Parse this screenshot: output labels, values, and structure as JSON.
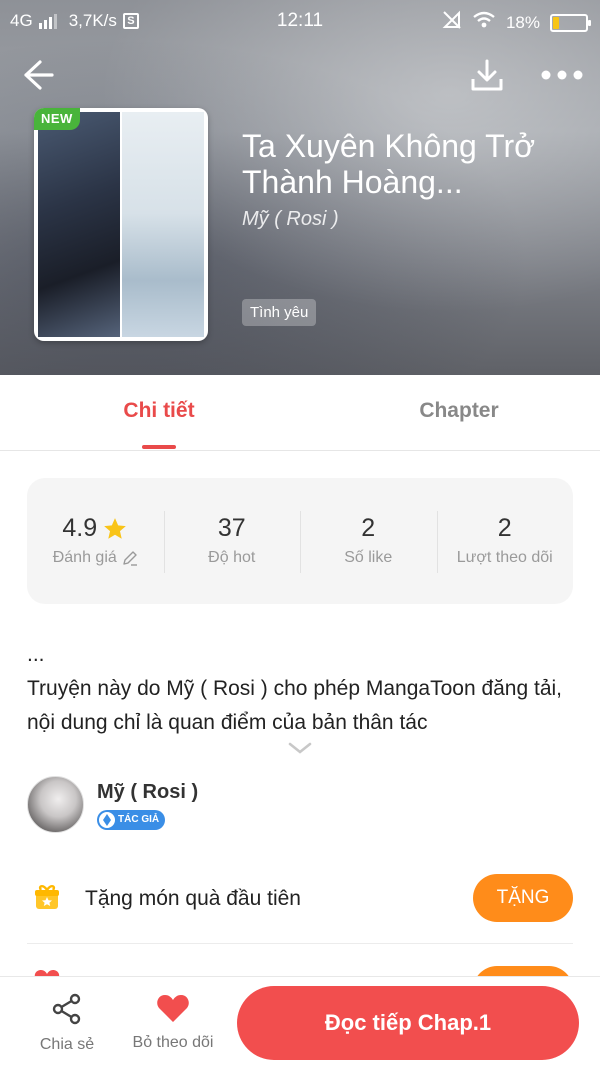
{
  "status_bar": {
    "network": "4G",
    "speed": "3,7K/s",
    "sim_icon": "S",
    "time": "12:11",
    "battery_percent": "18%",
    "battery_level": 0.18,
    "battery_color": "#f7c516"
  },
  "header": {
    "back_icon": "arrow-left-icon",
    "download_icon": "download-icon",
    "more_icon": "more-dots-icon"
  },
  "book": {
    "badge": "NEW",
    "title": "Ta Xuyên Không Trở Thành Hoàng...",
    "author": "Mỹ ( Rosi )",
    "genre": "Tình yêu"
  },
  "tabs": {
    "detail": "Chi tiết",
    "chapter": "Chapter",
    "active": "detail",
    "active_color": "#e94a4a"
  },
  "stats": {
    "rating_value": "4.9",
    "rating_label": "Đánh giá",
    "hot_value": "37",
    "hot_label": "Độ hot",
    "like_value": "2",
    "like_label": "Số like",
    "follow_value": "2",
    "follow_label": "Lượt theo dõi"
  },
  "description": {
    "ellipsis": "...",
    "text": "Truyện này do Mỹ ( Rosi ) cho phép MangaToon đăng tải, nội dung chỉ là quan điểm của bản thân tác"
  },
  "author_row": {
    "name": "Mỹ ( Rosi )",
    "badge": "TÁC GIẢ"
  },
  "gift": {
    "label": "Tặng món quà đầu tiên",
    "button": "TẶNG",
    "button_color": "#ff8c1a"
  },
  "bottom_bar": {
    "share_label": "Chia sẻ",
    "unfollow_label": "Bỏ theo dõi",
    "read_button": "Đọc tiếp Chap.1",
    "read_color": "#f24e4e"
  }
}
